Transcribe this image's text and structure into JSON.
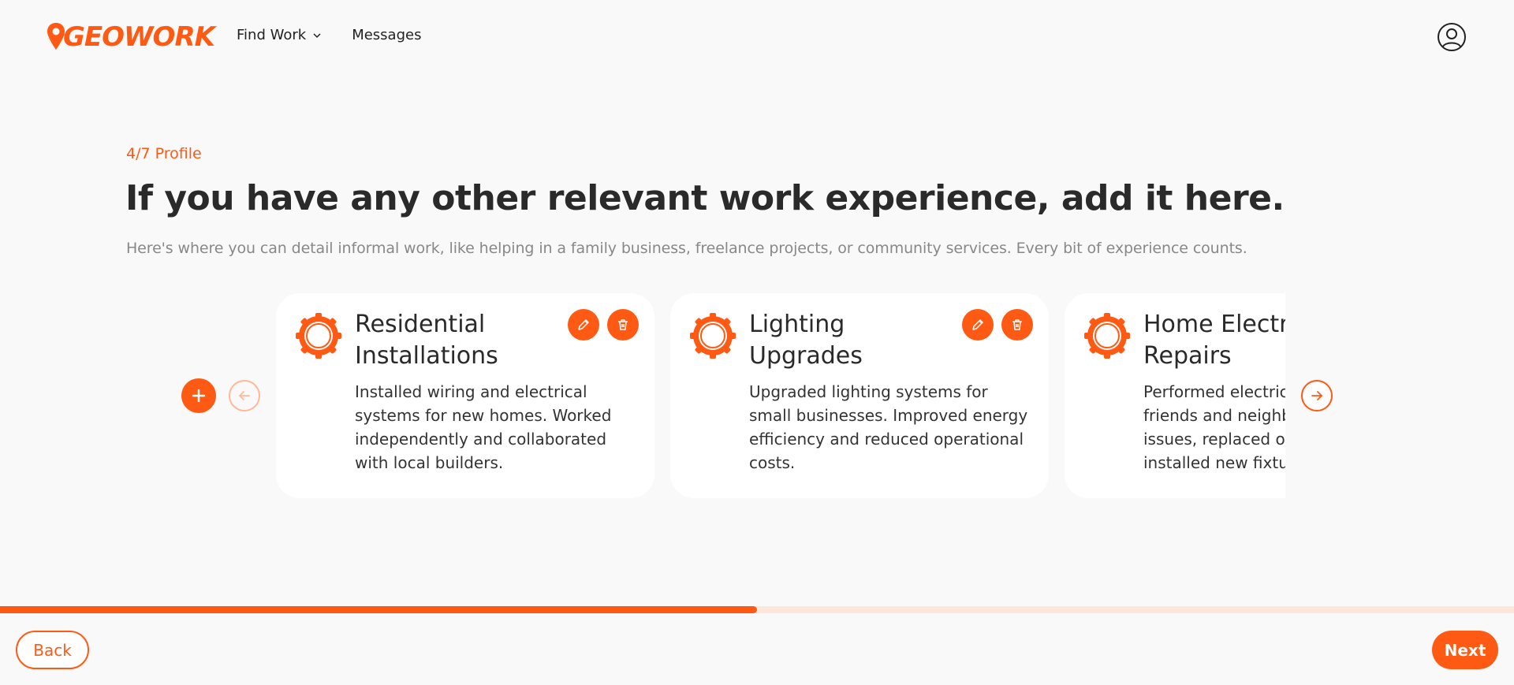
{
  "header": {
    "logo_text": "GEOWORK",
    "nav": [
      {
        "label": "Find Work",
        "has_dropdown": true
      },
      {
        "label": "Messages",
        "has_dropdown": false
      }
    ],
    "user_icon": "user-circle-icon"
  },
  "main": {
    "step_label": "4/7 Profile",
    "title": "If you have any other relevant work experience, add it here.",
    "subtitle": "Here's where you can detail informal work, like helping in a family business, freelance projects, or community services. Every bit of experience counts.",
    "cards": [
      {
        "title": "Residential Installations",
        "description": "Installed wiring and electrical systems for new homes. Worked independently and collaborated with local builders.",
        "icon": "gear-badge-icon"
      },
      {
        "title": "Lighting Upgrades",
        "description": "Upgraded lighting systems for small businesses. Improved energy efficiency and reduced operational costs.",
        "icon": "gear-badge-icon"
      },
      {
        "title": "Home Electrical Repairs",
        "description": "Performed electrical repairs for friends and neighbors. Fixed wiring issues, replaced outlets, and installed new fixtures.",
        "icon": "gear-badge-icon"
      }
    ]
  },
  "progress": {
    "fraction": 0.5
  },
  "footer": {
    "back_label": "Back",
    "next_label": "Next"
  },
  "colors": {
    "accent": "#ff5a14",
    "background": "#f9f9f9",
    "card": "#ffffff"
  }
}
